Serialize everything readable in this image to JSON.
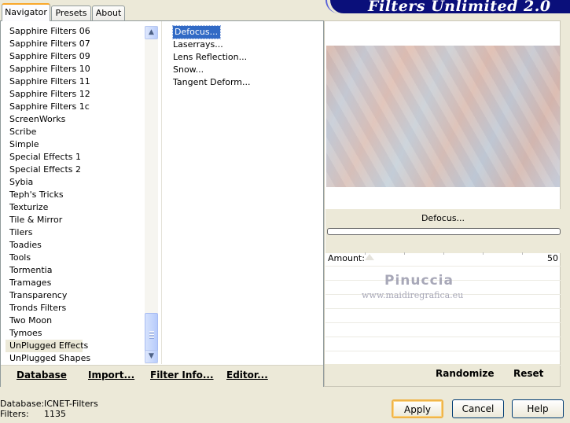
{
  "tabs": [
    "Navigator",
    "Presets",
    "About"
  ],
  "app_title": "Filters Unlimited 2.0",
  "categories": [
    "Sapphire Filters 06",
    "Sapphire Filters 07",
    "Sapphire Filters 09",
    "Sapphire Filters 10",
    "Sapphire Filters 11",
    "Sapphire Filters 12",
    "Sapphire Filters 1c",
    "ScreenWorks",
    "Scribe",
    "Simple",
    "Special Effects 1",
    "Special Effects 2",
    "Sybia",
    "Teph's Tricks",
    "Texturize",
    "Tile & Mirror",
    "Tilers",
    "Toadies",
    "Tools",
    "Tormentia",
    "Tramages",
    "Transparency",
    "Tronds Filters",
    "Two Moon",
    "Tymoes",
    "UnPlugged Effects",
    "UnPlugged Shapes"
  ],
  "selected_category": "UnPlugged Effects",
  "filters": [
    "Defocus...",
    "Laserrays...",
    "Lens Reflection...",
    "Snow...",
    "Tangent Deform..."
  ],
  "selected_filter": "Defocus...",
  "bottom_buttons": {
    "database": "Database",
    "import": "Import...",
    "filter_info": "Filter Info...",
    "editor": "Editor..."
  },
  "preview": {
    "filter_name": "Defocus...",
    "progress": 0
  },
  "parameters": [
    {
      "label": "Amount:",
      "value": "50"
    }
  ],
  "watermark": {
    "name": "Pinuccia",
    "url": "www.maidiregrafica.eu"
  },
  "right_buttons": {
    "randomize": "Randomize",
    "reset": "Reset"
  },
  "footer": {
    "database_label": "Database:",
    "database_value": "ICNET-Filters",
    "filters_label": "Filters:",
    "filters_value": "1135"
  },
  "dialog_buttons": {
    "apply": "Apply",
    "cancel": "Cancel",
    "help": "Help"
  }
}
